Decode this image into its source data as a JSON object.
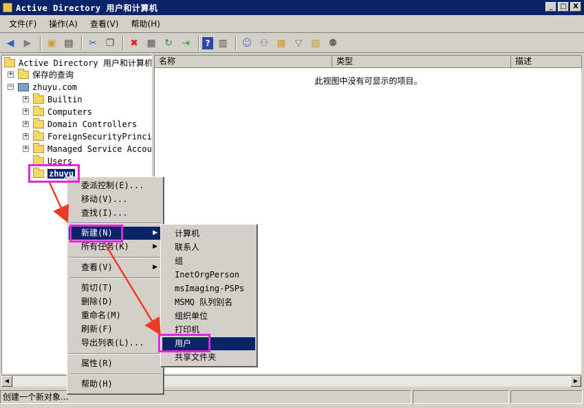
{
  "window": {
    "title": "Active Directory 用户和计算机",
    "controls": {
      "minimize": "_",
      "maximize": "□",
      "close": "X"
    }
  },
  "menubar": [
    "文件(F)",
    "操作(A)",
    "查看(V)",
    "帮助(H)"
  ],
  "toolbar": {
    "icons": [
      "back-icon",
      "forward-icon",
      "up-folder-icon",
      "show-tree-icon",
      "cut-icon",
      "copy-icon",
      "delete-icon",
      "properties-icon",
      "refresh-icon",
      "export-icon",
      "help-icon",
      "console-icon",
      "users-icon",
      "group-icon",
      "ou-icon",
      "filter-icon",
      "find-icon",
      "delegate-icon"
    ]
  },
  "tree": {
    "root": "Active Directory 用户和计算机",
    "saved_queries": "保存的查询",
    "domain": "zhuyu.com",
    "children": [
      "Builtin",
      "Computers",
      "Domain Controllers",
      "ForeignSecurityPrincip",
      "Managed Service Accour",
      "Users",
      "zhuyu"
    ]
  },
  "list": {
    "columns": [
      "名称",
      "类型",
      "描述"
    ],
    "empty_message": "此视图中没有可显示的项目。"
  },
  "context_menu": {
    "items": [
      "委派控制(E)...",
      "移动(V)...",
      "查找(I)...",
      "新建(N)",
      "所有任务(K)",
      "查看(V)",
      "剪切(T)",
      "删除(D)",
      "重命名(M)",
      "刷新(F)",
      "导出列表(L)...",
      "属性(R)",
      "帮助(H)"
    ]
  },
  "submenu": {
    "items": [
      "计算机",
      "联系人",
      "组",
      "InetOrgPerson",
      "msImaging-PSPs",
      "MSMQ 队列别名",
      "组织单位",
      "打印机",
      "用户",
      "共享文件夹"
    ]
  },
  "status": {
    "text": "创建一个新对象..."
  },
  "colors": {
    "highlight": "#e026e0",
    "selection": "#0a246a",
    "arrow": "#ee3a2a"
  }
}
